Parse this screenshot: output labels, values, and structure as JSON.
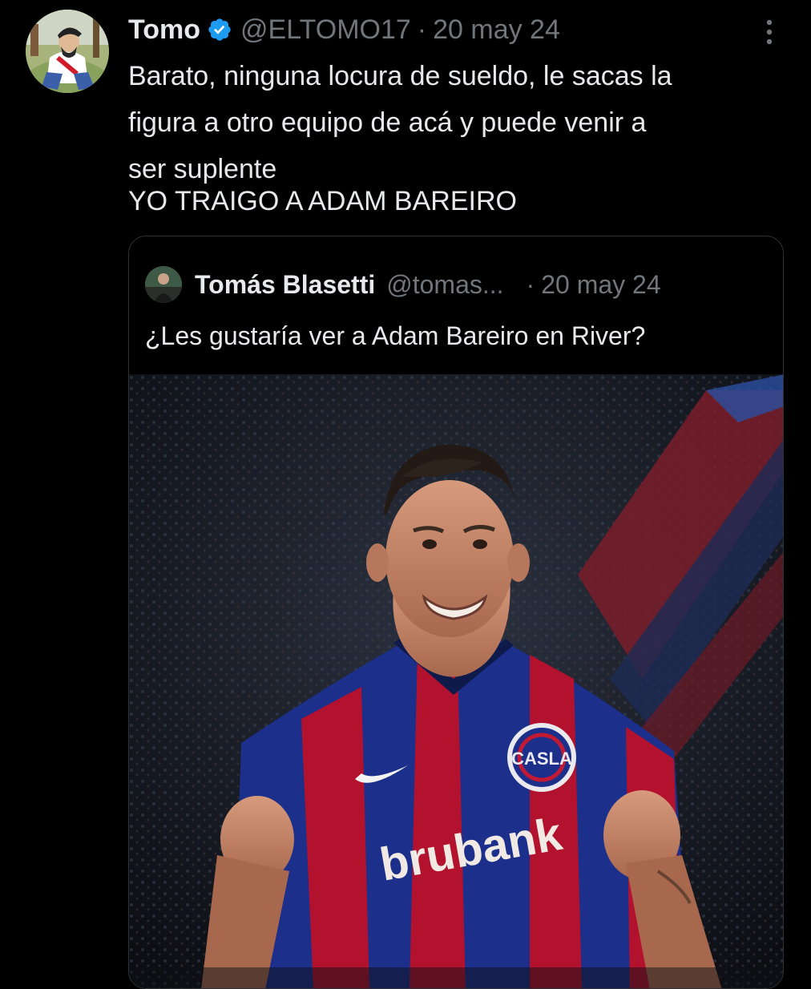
{
  "tweet": {
    "author_name": "Tomo",
    "author_handle": "@ELTOMO17",
    "separator": "·",
    "date": "20 may 24",
    "body": "Barato, ninguna locura de sueldo, le sacas la\nfigura a otro equipo de acá y puede venir a\nser suplente",
    "body_last_line": "YO TRAIGO A ADAM BAREIRO",
    "icons": {
      "verified": "verified-badge-icon",
      "more": "more-options-icon"
    },
    "colors": {
      "background": "#000000",
      "text": "#e7e9ea",
      "muted": "#71767b",
      "verified": "#1d9bf0",
      "border": "#2f3336"
    }
  },
  "quoted": {
    "author_name": "Tomás Blasetti",
    "author_handle": "@tomas...",
    "separator": "·",
    "date": "20 may 24",
    "text": "¿Les gustaría ver a Adam Bareiro en River?",
    "photo": {
      "sponsor": "brubank",
      "crest": "CASLA",
      "colors": {
        "shirt_blue": "#1c2f8a",
        "shirt_red": "#b3122e"
      }
    }
  }
}
